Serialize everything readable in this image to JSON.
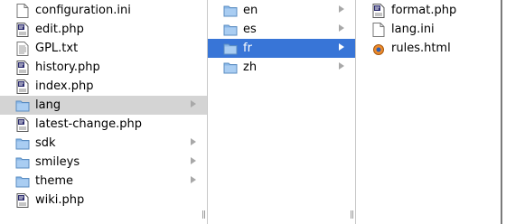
{
  "columns": [
    {
      "items": [
        {
          "name": "configuration.ini",
          "icon": "blank-document-icon",
          "has_children": false,
          "state": "normal"
        },
        {
          "name": "edit.php",
          "icon": "php-file-icon",
          "has_children": false,
          "state": "normal"
        },
        {
          "name": "GPL.txt",
          "icon": "text-document-icon",
          "has_children": false,
          "state": "normal"
        },
        {
          "name": "history.php",
          "icon": "php-file-icon",
          "has_children": false,
          "state": "normal"
        },
        {
          "name": "index.php",
          "icon": "php-file-icon",
          "has_children": false,
          "state": "normal"
        },
        {
          "name": "lang",
          "icon": "folder-icon",
          "has_children": true,
          "state": "highlight"
        },
        {
          "name": "latest-change.php",
          "icon": "php-file-icon",
          "has_children": false,
          "state": "normal"
        },
        {
          "name": "sdk",
          "icon": "folder-icon",
          "has_children": true,
          "state": "normal"
        },
        {
          "name": "smileys",
          "icon": "folder-icon",
          "has_children": true,
          "state": "normal"
        },
        {
          "name": "theme",
          "icon": "folder-icon",
          "has_children": true,
          "state": "normal"
        },
        {
          "name": "wiki.php",
          "icon": "php-file-icon",
          "has_children": false,
          "state": "normal"
        }
      ]
    },
    {
      "items": [
        {
          "name": "en",
          "icon": "folder-icon",
          "has_children": true,
          "state": "normal"
        },
        {
          "name": "es",
          "icon": "folder-icon",
          "has_children": true,
          "state": "normal"
        },
        {
          "name": "fr",
          "icon": "folder-icon",
          "has_children": true,
          "state": "selected"
        },
        {
          "name": "zh",
          "icon": "folder-icon",
          "has_children": true,
          "state": "normal"
        }
      ]
    },
    {
      "items": [
        {
          "name": "format.php",
          "icon": "php-file-icon",
          "has_children": false,
          "state": "normal"
        },
        {
          "name": "lang.ini",
          "icon": "blank-document-icon",
          "has_children": false,
          "state": "normal"
        },
        {
          "name": "rules.html",
          "icon": "html-file-icon",
          "has_children": false,
          "state": "normal"
        }
      ]
    }
  ],
  "colors": {
    "selection": "#3875d7",
    "highlight": "#d4d4d4",
    "folder": "#8ab8e8"
  }
}
